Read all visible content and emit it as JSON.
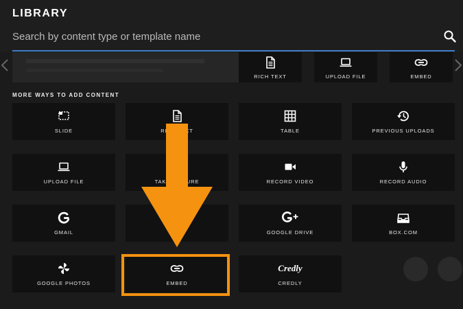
{
  "header": {
    "title": "LIBRARY",
    "search_placeholder": "Search by content type or template name"
  },
  "top_row": [
    {
      "label": "RICH TEXT",
      "icon": "document-icon"
    },
    {
      "label": "UPLOAD FILE",
      "icon": "laptop-icon"
    },
    {
      "label": "EMBED",
      "icon": "link-icon"
    }
  ],
  "section": {
    "label": "MORE WAYS TO ADD CONTENT"
  },
  "tiles": [
    {
      "label": "SLIDE",
      "icon": "slide-icon"
    },
    {
      "label": "RICH TEXT",
      "icon": "document-icon"
    },
    {
      "label": "TABLE",
      "icon": "table-icon"
    },
    {
      "label": "PREVIOUS UPLOADS",
      "icon": "history-icon"
    },
    {
      "label": "UPLOAD FILE",
      "icon": "laptop-icon"
    },
    {
      "label": "TAKE PICTURE",
      "icon": "camera-icon"
    },
    {
      "label": "RECORD VIDEO",
      "icon": "video-camera-icon"
    },
    {
      "label": "RECORD AUDIO",
      "icon": "microphone-icon"
    },
    {
      "label": "GMAIL",
      "icon": "google-icon"
    },
    {
      "label": "",
      "icon": ""
    },
    {
      "label": "GOOGLE DRIVE",
      "icon": "google-plus-icon"
    },
    {
      "label": "BOX.COM",
      "icon": "inbox-tray-icon"
    },
    {
      "label": "GOOGLE PHOTOS",
      "icon": "pinwheel-icon"
    },
    {
      "label": "EMBED",
      "icon": "link-icon"
    },
    {
      "label": "CREDLY",
      "icon": "credly-logo-icon",
      "logo_text": "Credly"
    }
  ],
  "colors": {
    "highlight": "#f5920f",
    "search_underline": "#3d7fc8",
    "tile_background": "#111111",
    "page_background": "#1b1b1b"
  }
}
